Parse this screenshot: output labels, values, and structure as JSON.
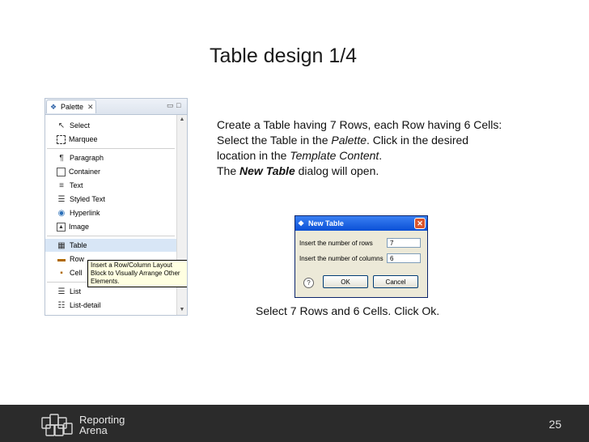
{
  "slide": {
    "title": "Table design 1/4",
    "page_number": "25"
  },
  "instructions": {
    "line1": "Create a Table having 7 Rows, each Row having 6 Cells:",
    "line2_prefix": "Select the Table in the ",
    "line2_italic": "Palette",
    "line2_suffix": ". Click in the desired",
    "line3_prefix": "location in the ",
    "line3_italic": "Template Content",
    "line3_suffix": ".",
    "line4_prefix": "The ",
    "line4_bold": "New Table",
    "line4_suffix": " dialog will open."
  },
  "caption": "Select 7 Rows and 6 Cells. Click Ok.",
  "palette": {
    "tab_label": "Palette",
    "items_group1": [
      {
        "label": "Select",
        "icon": "arrow-cursor-icon"
      },
      {
        "label": "Marquee",
        "icon": "marquee-icon"
      }
    ],
    "items_group2": [
      {
        "label": "Paragraph",
        "icon": "pilcrow-icon"
      },
      {
        "label": "Container",
        "icon": "container-icon"
      },
      {
        "label": "Text",
        "icon": "text-icon"
      },
      {
        "label": "Styled Text",
        "icon": "styled-text-icon"
      },
      {
        "label": "Hyperlink",
        "icon": "globe-link-icon"
      },
      {
        "label": "Image",
        "icon": "image-icon"
      }
    ],
    "items_group3": [
      {
        "label": "Table",
        "icon": "table-icon"
      },
      {
        "label": "Row",
        "icon": "row-icon"
      },
      {
        "label": "Cell",
        "icon": "cell-icon"
      }
    ],
    "items_group4": [
      {
        "label": "List",
        "icon": "list-icon"
      },
      {
        "label": "List-detail",
        "icon": "list-detail-icon"
      }
    ],
    "tooltip": "Insert a Row/Column Layout Block to Visually Arrange Other Elements."
  },
  "dialog": {
    "title": "New Table",
    "rows_label": "Insert the number of rows",
    "rows_value": "7",
    "cols_label": "Insert the number of columns",
    "cols_value": "6",
    "ok_label": "OK",
    "cancel_label": "Cancel"
  },
  "footer": {
    "brand_line1": "Reporting",
    "brand_line2": "Arena"
  }
}
